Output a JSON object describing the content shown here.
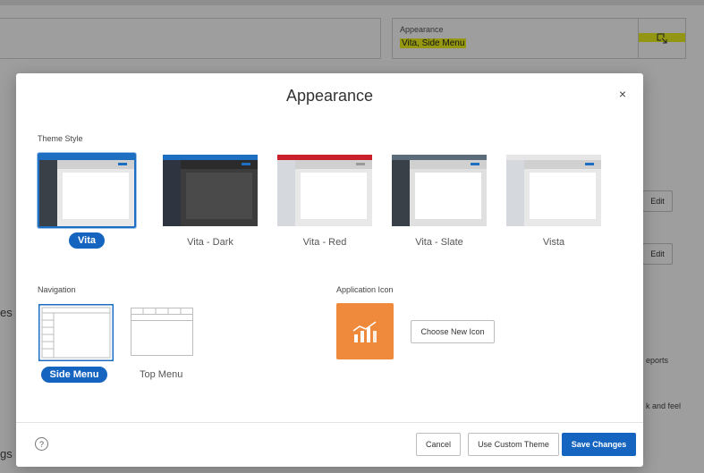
{
  "background": {
    "appearance_label": "Appearance",
    "appearance_value": "Vita, Side Menu",
    "edit_label": "Edit",
    "side_texts": [
      "es",
      "eports",
      "k and feel",
      "gs"
    ]
  },
  "dialog": {
    "title": "Appearance",
    "close_glyph": "×",
    "theme_style_label": "Theme Style",
    "themes": [
      {
        "label": "Vita",
        "selected": true,
        "sidebar": "#3a4048",
        "header": "#1e6ec2",
        "content_bg": "#e8e8e8"
      },
      {
        "label": "Vita - Dark",
        "selected": false,
        "sidebar": "#2f3540",
        "header": "#1e6ec2",
        "content_bg": "#3c3c3c"
      },
      {
        "label": "Vita - Red",
        "selected": false,
        "sidebar": "#d5d8dc",
        "header": "#c9202c",
        "content_bg": "#e8e8e8"
      },
      {
        "label": "Vita - Slate",
        "selected": false,
        "sidebar": "#3a4048",
        "header": "#5c6b7a",
        "content_bg": "#e0e0e0"
      },
      {
        "label": "Vista",
        "selected": false,
        "sidebar": "#d5d8dc",
        "header": "#e6e6e6",
        "content_bg": "#e8e8e8"
      }
    ],
    "navigation_label": "Navigation",
    "navigation": [
      {
        "label": "Side Menu",
        "selected": true
      },
      {
        "label": "Top Menu",
        "selected": false
      }
    ],
    "app_icon_label": "Application Icon",
    "choose_icon_label": "Choose New Icon",
    "help_glyph": "?",
    "buttons": {
      "cancel": "Cancel",
      "custom_theme": "Use Custom Theme",
      "save": "Save Changes"
    }
  },
  "colors": {
    "accent": "#1565c0",
    "app_icon_bg": "#ef8a3c",
    "highlight": "#f0f51a"
  }
}
